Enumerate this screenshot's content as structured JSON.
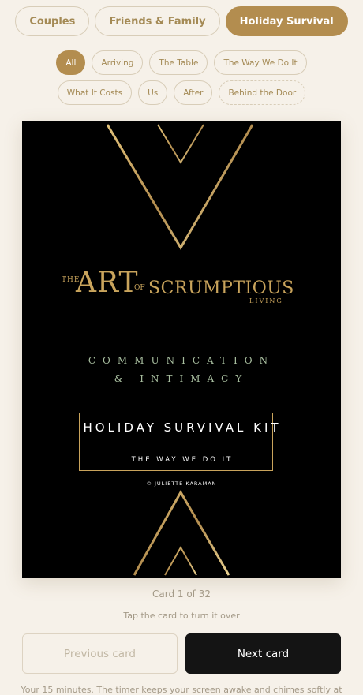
{
  "tabs": [
    {
      "label": "Couples",
      "active": false
    },
    {
      "label": "Friends & Family",
      "active": false
    },
    {
      "label": "Holiday Survival",
      "active": true
    }
  ],
  "filters_row1": [
    {
      "label": "All",
      "active": true
    },
    {
      "label": "Arriving",
      "active": false
    },
    {
      "label": "The Table",
      "active": false
    },
    {
      "label": "The Way We Do It",
      "active": false
    }
  ],
  "filters_row2": [
    {
      "label": "What It Costs",
      "active": false
    },
    {
      "label": "Us",
      "active": false
    },
    {
      "label": "After",
      "active": false
    },
    {
      "label": "Behind the Door",
      "active": false
    }
  ],
  "card": {
    "brand_the": "THE",
    "brand_art": "ART",
    "brand_of": "OF",
    "brand_scrumptious": "SCRUMPTIOUS",
    "brand_living": "LIVING",
    "line1": "COMMUNICATION",
    "line2": "& INTIMACY",
    "kit_title": "HOLIDAY SURVIVAL KIT",
    "kit_subtitle": "THE WAY WE DO IT",
    "copyright": "© JULIETTE KARAMAN"
  },
  "counter": "Card 1 of 32",
  "hint": "Tap the card to turn it over",
  "buttons": {
    "previous": "Previous card",
    "next": "Next card"
  },
  "footer": "Your 15 minutes. The timer keeps your screen awake and chimes softly at",
  "colors": {
    "accent": "#b38d4f",
    "gold": "#c9a45c",
    "card_bg": "#000000",
    "page_bg": "#f6f1e9"
  }
}
